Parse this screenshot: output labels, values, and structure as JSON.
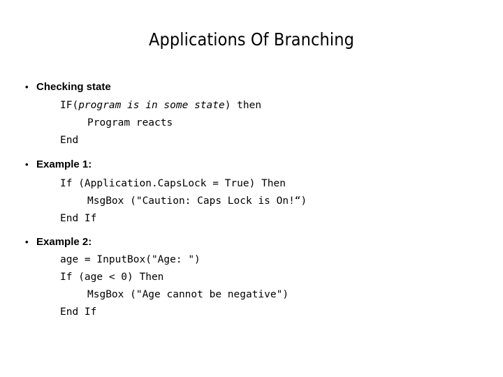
{
  "slide": {
    "title": "Applications Of Branching",
    "background_color": "#ffffff",
    "text_color": "#000000",
    "bullet_glyph": "•"
  },
  "sections": [
    {
      "id": "checking",
      "heading": "Checking state",
      "code": [
        {
          "indent": 0,
          "segments": [
            {
              "text": "IF(",
              "style": "normal"
            },
            {
              "text": "program is in some state",
              "style": "italic"
            },
            {
              "text": ") then",
              "style": "normal"
            }
          ]
        },
        {
          "indent": 1,
          "segments": [
            {
              "text": "Program reacts",
              "style": "normal"
            }
          ]
        },
        {
          "indent": 0,
          "segments": [
            {
              "text": "End",
              "style": "normal"
            }
          ]
        }
      ]
    },
    {
      "id": "example1",
      "heading": "Example 1:",
      "code": [
        {
          "indent": 0,
          "segments": [
            {
              "text": "If (Application.CapsLock = True) Then",
              "style": "normal"
            }
          ]
        },
        {
          "indent": 1,
          "segments": [
            {
              "text": "MsgBox (\"Caution: Caps Lock is On!“)",
              "style": "normal"
            }
          ]
        },
        {
          "indent": 0,
          "segments": [
            {
              "text": "End If",
              "style": "normal"
            }
          ]
        }
      ]
    },
    {
      "id": "example2",
      "heading": "Example 2:",
      "code": [
        {
          "indent": 0,
          "segments": [
            {
              "text": "age = InputBox(\"Age: \")",
              "style": "normal"
            }
          ]
        },
        {
          "indent": 0,
          "segments": [
            {
              "text": "If (age < 0) Then",
              "style": "normal"
            }
          ]
        },
        {
          "indent": 1,
          "segments": [
            {
              "text": "MsgBox (\"Age cannot be negative\")",
              "style": "normal"
            }
          ]
        },
        {
          "indent": 0,
          "segments": [
            {
              "text": "End If",
              "style": "normal"
            }
          ]
        }
      ]
    }
  ]
}
